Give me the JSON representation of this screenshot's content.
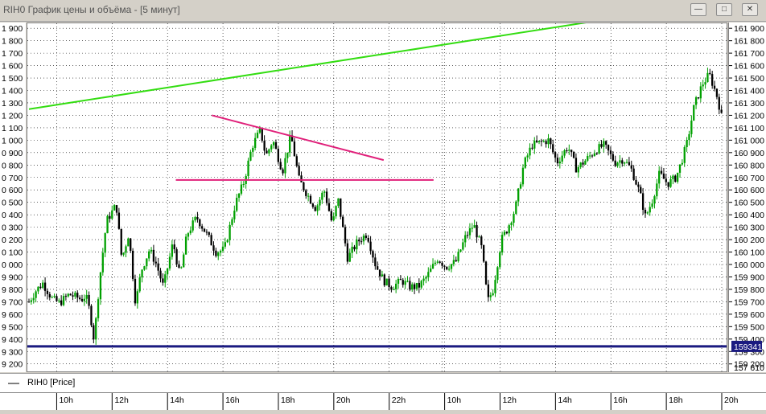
{
  "window": {
    "title": "RIH0 График цены и объёма - [5 минут]",
    "buttons": [
      "minimize-icon",
      "restore-icon",
      "close-icon"
    ]
  },
  "legend": {
    "label": "RIH0 [Price]"
  },
  "colors": {
    "bull": "#00a000",
    "bear": "#000000",
    "trend_up": "#33dd11",
    "trend_down": "#e0207a",
    "level": "#e0207a",
    "support": "#1a1a80",
    "last_price_bg": "#1a1a80"
  },
  "chart_data": {
    "type": "candlestick",
    "title": "",
    "ylim": [
      159140,
      161940
    ],
    "y_ticks_left": [
      "1 900",
      "1 800",
      "1 700",
      "1 600",
      "1 500",
      "1 400",
      "1 300",
      "1 200",
      "1 100",
      "1 000",
      "0 900",
      "0 800",
      "0 700",
      "0 600",
      "0 500",
      "0 400",
      "0 300",
      "0 200",
      "0 100",
      "0 000",
      "9 900",
      "9 800",
      "9 700",
      "9 600",
      "9 500",
      "9 400",
      "9 300",
      "9 200"
    ],
    "y_ticks_right": [
      "161 900",
      "161 800",
      "161 700",
      "161 600",
      "161 500",
      "161 400",
      "161 300",
      "161 200",
      "161 100",
      "161 000",
      "160 900",
      "160 800",
      "160 700",
      "160 600",
      "160 500",
      "160 400",
      "160 300",
      "160 200",
      "160 100",
      "160 000",
      "159 900",
      "159 800",
      "159 700",
      "159 600",
      "159 500",
      "159 400",
      "159 300",
      "159 200"
    ],
    "y_tick_values": [
      161900,
      161800,
      161700,
      161600,
      161500,
      161400,
      161300,
      161200,
      161100,
      161000,
      160900,
      160800,
      160700,
      160600,
      160500,
      160400,
      160300,
      160200,
      160100,
      160000,
      159900,
      159800,
      159700,
      159600,
      159500,
      159400,
      159300,
      159200
    ],
    "bottom_right_label": "157 610",
    "last_price_label": "159341",
    "last_price": 159341,
    "x_ticks": [
      "10h",
      "12h",
      "14h",
      "16h",
      "18h",
      "20h",
      "22h",
      "10h",
      "12h",
      "14h",
      "16h",
      "18h",
      "20h"
    ],
    "x_tick_times": [
      1,
      3,
      5,
      7,
      9,
      11,
      13,
      15,
      17,
      19,
      21,
      23,
      25
    ],
    "session_break_time": 14.9,
    "xlim": [
      0,
      25
    ],
    "grid": true,
    "horizontal_lines": [
      {
        "name": "support",
        "value": 159341
      },
      {
        "name": "resistance",
        "value": 160680
      }
    ],
    "trendlines": [
      {
        "name": "rising-trendline",
        "from": [
          0,
          161250
        ],
        "to": [
          20.5,
          161960
        ]
      },
      {
        "name": "falling-trendline",
        "from": [
          6.6,
          161200
        ],
        "to": [
          12.8,
          160840
        ]
      }
    ],
    "anchors": [
      [
        0,
        159700
      ],
      [
        0.25,
        159790
      ],
      [
        0.5,
        159850
      ],
      [
        0.85,
        159720
      ],
      [
        1.1,
        159690
      ],
      [
        1.45,
        159760
      ],
      [
        1.9,
        159720
      ],
      [
        2.05,
        159750
      ],
      [
        2.2,
        159620
      ],
      [
        2.35,
        159390
      ],
      [
        2.55,
        159880
      ],
      [
        2.8,
        160350
      ],
      [
        3.15,
        160480
      ],
      [
        3.35,
        160040
      ],
      [
        3.6,
        160250
      ],
      [
        3.85,
        159680
      ],
      [
        4.05,
        159950
      ],
      [
        4.35,
        160120
      ],
      [
        4.6,
        160000
      ],
      [
        4.85,
        159820
      ],
      [
        5.2,
        160180
      ],
      [
        5.45,
        159900
      ],
      [
        5.7,
        160240
      ],
      [
        6.05,
        160380
      ],
      [
        6.45,
        160230
      ],
      [
        6.75,
        160100
      ],
      [
        7.05,
        160120
      ],
      [
        7.45,
        160490
      ],
      [
        7.75,
        160660
      ],
      [
        8.05,
        160950
      ],
      [
        8.35,
        161080
      ],
      [
        8.55,
        160870
      ],
      [
        8.8,
        161000
      ],
      [
        9.15,
        160750
      ],
      [
        9.45,
        161040
      ],
      [
        9.75,
        160680
      ],
      [
        10.05,
        160560
      ],
      [
        10.35,
        160450
      ],
      [
        10.65,
        160600
      ],
      [
        10.95,
        160320
      ],
      [
        11.15,
        160530
      ],
      [
        11.5,
        160050
      ],
      [
        11.85,
        160180
      ],
      [
        12.2,
        160250
      ],
      [
        12.5,
        160000
      ],
      [
        12.8,
        159870
      ],
      [
        13.1,
        159820
      ],
      [
        13.45,
        159870
      ],
      [
        13.75,
        159820
      ],
      [
        14.05,
        159820
      ],
      [
        14.35,
        159900
      ],
      [
        14.75,
        160050
      ],
      [
        15.05,
        159980
      ],
      [
        15.4,
        160020
      ],
      [
        15.75,
        160220
      ],
      [
        16.05,
        160320
      ],
      [
        16.35,
        160120
      ],
      [
        16.55,
        159700
      ],
      [
        16.75,
        159800
      ],
      [
        17.05,
        160200
      ],
      [
        17.25,
        160280
      ],
      [
        17.55,
        160450
      ],
      [
        17.85,
        160800
      ],
      [
        18.15,
        160960
      ],
      [
        18.45,
        160980
      ],
      [
        18.75,
        161000
      ],
      [
        19.05,
        160820
      ],
      [
        19.45,
        160950
      ],
      [
        19.75,
        160770
      ],
      [
        20.05,
        160830
      ],
      [
        20.45,
        160920
      ],
      [
        20.75,
        160960
      ],
      [
        21.15,
        160820
      ],
      [
        21.45,
        160850
      ],
      [
        21.75,
        160760
      ],
      [
        22.05,
        160570
      ],
      [
        22.25,
        160380
      ],
      [
        22.5,
        160520
      ],
      [
        22.75,
        160730
      ],
      [
        23.05,
        160650
      ],
      [
        23.35,
        160700
      ],
      [
        23.55,
        160830
      ],
      [
        23.75,
        160980
      ],
      [
        24.0,
        161270
      ],
      [
        24.3,
        161450
      ],
      [
        24.55,
        161530
      ],
      [
        24.85,
        161340
      ],
      [
        25.0,
        161180
      ]
    ]
  }
}
